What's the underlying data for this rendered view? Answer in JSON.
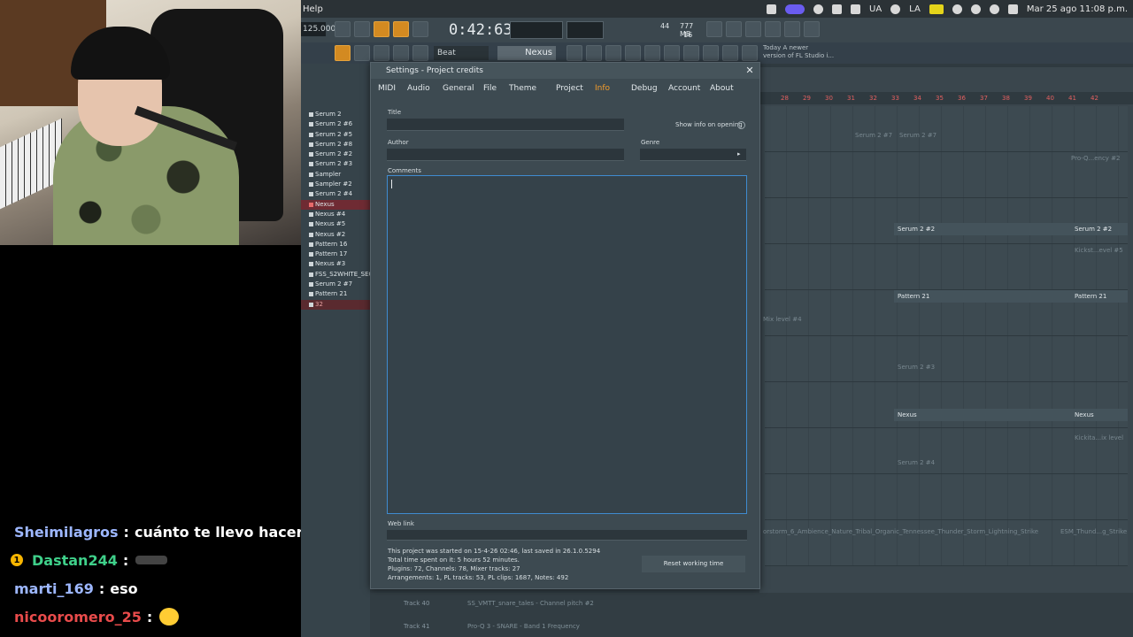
{
  "chat": [
    {
      "user": "Sheimilagros",
      "user_color": "#9db7ff",
      "badge": "",
      "message": "cuánto te llevo hacerlo ?"
    },
    {
      "user": "Dastan244",
      "user_color": "#3fd08a",
      "badge": "1",
      "message": ""
    },
    {
      "user": "marti_169",
      "user_color": "#9db7ff",
      "badge": "",
      "message": "eso"
    },
    {
      "user": "nicooromero_25",
      "user_color": "#e84b4b",
      "badge": "",
      "message": ""
    }
  ],
  "menubar": {
    "help": "Help",
    "lang": "UA",
    "lang2": "LA",
    "clock": "Mar 25 ago  11:08 p.m."
  },
  "toolbar": {
    "tempo": "125.000",
    "time": "0:42:63",
    "cpu_a": "44",
    "cpu_b": "777 MB",
    "cpu_c": "16",
    "pattern": "Beat",
    "channel": "Nexus",
    "news_line1": "Today  A newer",
    "news_line2": "version of FL Studio i..."
  },
  "browser": {
    "items": [
      "Serum 2",
      "Serum 2 #6",
      "Serum 2 #5",
      "Serum 2 #8",
      "Serum 2 #2",
      "Serum 2 #3",
      "Sampler",
      "Sampler #2",
      "Serum 2 #4",
      "Nexus",
      "Nexus #4",
      "Nexus #5",
      "Nexus #2",
      "Pattern 16",
      "Pattern 17",
      "Nexus #3",
      "FSS_S2WHITE_SEQ_5",
      "Serum 2 #7",
      "Pattern 21",
      "32"
    ]
  },
  "playlist": {
    "ruler": [
      "28",
      "29",
      "30",
      "31",
      "32",
      "33",
      "34",
      "35",
      "36",
      "37",
      "38",
      "39",
      "40",
      "41",
      "42"
    ],
    "clips": {
      "serum7a": "Serum 2 #7",
      "serum7b": "Serum 2 #7",
      "proq": "Pro-Q...ency #2",
      "serum2a": "Serum 2 #2",
      "serum2b": "Serum 2 #2",
      "kick": "Kickst...evel #5",
      "pattern21a": "Pattern 21",
      "pattern21b": "Pattern 21",
      "mixlevel": "Mix level #4",
      "serum3": "Serum 2 #3",
      "nexusa": "Nexus",
      "nexusb": "Nexus",
      "kick2": "Kickita...ix level",
      "serum4": "Serum 2 #4",
      "ambience": "orstorm_6_Ambience_Nature_Tribal_Organic_Tennessee_Thunder_Storm_Lightning_Strike",
      "esm": "ESM_Thund...g_Strike"
    }
  },
  "dialog": {
    "title": "Settings - Project credits",
    "tabs": [
      "MIDI",
      "Audio",
      "General",
      "File",
      "Theme",
      "Project",
      "Info",
      "Debug",
      "Account",
      "About"
    ],
    "active_tab": "Info",
    "title_label": "Title",
    "author_label": "Author",
    "genre_label": "Genre",
    "comments_label": "Comments",
    "show_info": "Show info on opening",
    "weblink_label": "Web link",
    "stats": [
      "This project was started on 15-4-26 02:46, last saved in 26.1.0.5294",
      "Total time spent on it:  5 hours 52 minutes.",
      "Plugins: 72, Channels: 78, Mixer tracks: 27",
      "Arrangements: 1, PL tracks: 53, PL clips: 1687, Notes: 492"
    ],
    "reset_button": "Reset working time"
  },
  "bottom": {
    "track40": "Track 40",
    "track41": "Track 41",
    "row1": "SS_VMTT_snare_tales - Channel pitch #2",
    "row2": "Pro-Q 3 - SNARE - Band 1 Frequency"
  }
}
